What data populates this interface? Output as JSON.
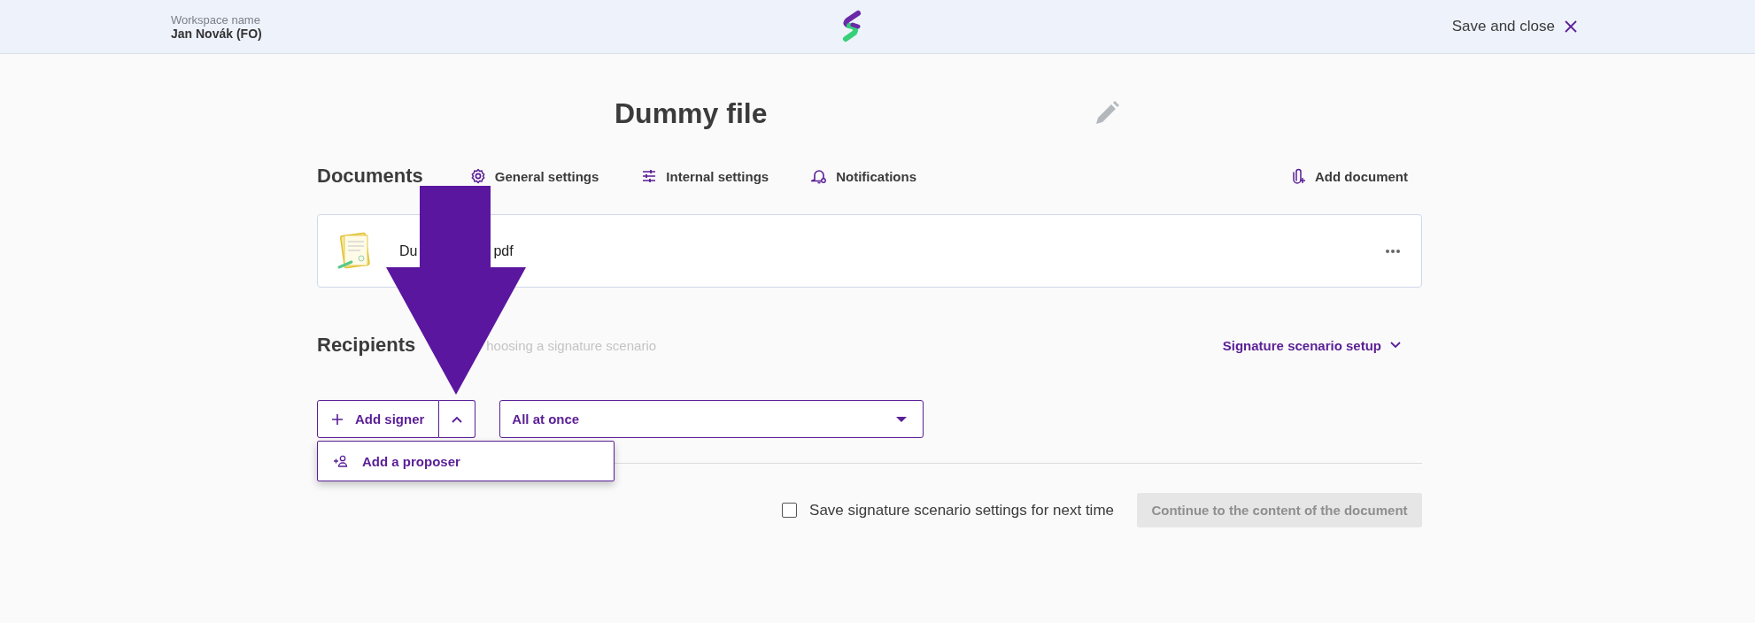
{
  "header": {
    "workspace_label": "Workspace name",
    "workspace_name": "Jan Novák (FO)",
    "save_close": "Save and close"
  },
  "title": "Dummy file",
  "documents": {
    "heading": "Documents",
    "actions": [
      {
        "label": "General settings"
      },
      {
        "label": "Internal settings"
      },
      {
        "label": "Notifications"
      }
    ],
    "add": {
      "label": "Add document"
    },
    "files": [
      {
        "name_start": "Du",
        "name_end": "pdf"
      }
    ]
  },
  "recipients": {
    "heading": "Recipients",
    "hint": "hoosing a signature scenario",
    "setup": "Signature scenario setup",
    "add_signer": "Add signer",
    "menu_open": true,
    "menu": [
      {
        "label": "Add a proposer"
      }
    ],
    "order": {
      "value": "All at once"
    }
  },
  "footer": {
    "save_settings": {
      "label": "Save signature scenario settings for next time",
      "checked": false
    },
    "continue": {
      "label": "Continue to the content of the document",
      "disabled": true
    }
  }
}
